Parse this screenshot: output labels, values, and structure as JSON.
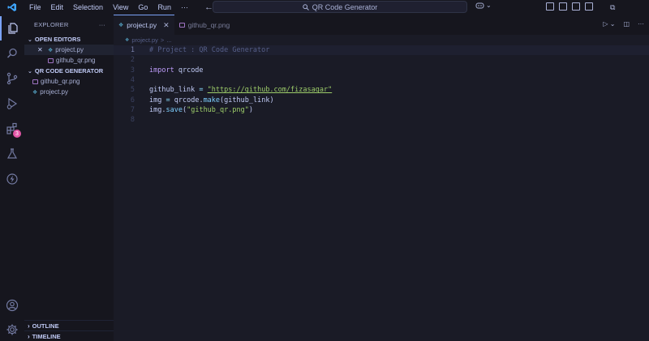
{
  "titlebar": {
    "menu": [
      "File",
      "Edit",
      "Selection",
      "View",
      "Go",
      "Run",
      "···"
    ],
    "search_text": "QR Code Generator"
  },
  "activitybar": {
    "extensions_badge": "3"
  },
  "sidebar": {
    "header": "EXPLORER",
    "header_more": "···",
    "open_editors_title": "OPEN EDITORS",
    "open_editors": [
      {
        "name": "project.py",
        "close": "✕",
        "type": "python"
      },
      {
        "name": "github_qr.png",
        "type": "image"
      }
    ],
    "folder_title": "QR CODE GENERATOR",
    "files": [
      {
        "name": "github_qr.png",
        "type": "image"
      },
      {
        "name": "project.py",
        "type": "python"
      }
    ],
    "outline_title": "OUTLINE",
    "timeline_title": "TIMELINE"
  },
  "editor": {
    "tabs": [
      {
        "label": "project.py",
        "close": "✕",
        "active": true
      },
      {
        "label": "github_qr.png",
        "active": false
      }
    ],
    "breadcrumb": {
      "file": "project.py",
      "sep": ">",
      "rest": "..."
    },
    "lines": [
      "1",
      "2",
      "3",
      "4",
      "5",
      "6",
      "7",
      "8"
    ],
    "code": {
      "l1": "# Project : QR Code Generator",
      "l3_kw": "import",
      "l3_mod": " qrcode",
      "l5_var": "github_link ",
      "l5_eq": "= ",
      "l5_str": "\"https://github.com/fizasagar\"",
      "l6_var": "img ",
      "l6_eq": "= ",
      "l6_mod": "qrcode.",
      "l6_fn": "make",
      "l6_args": "(github_link)",
      "l7_obj": "img.",
      "l7_fn": "save",
      "l7_open": "(",
      "l7_str": "\"github_qr.png\"",
      "l7_close": ")"
    }
  },
  "colors": {
    "accent": "#7aa2f7",
    "badge": "#e356a7",
    "background": "#1a1b26",
    "sidebar_bg": "#16161e"
  }
}
